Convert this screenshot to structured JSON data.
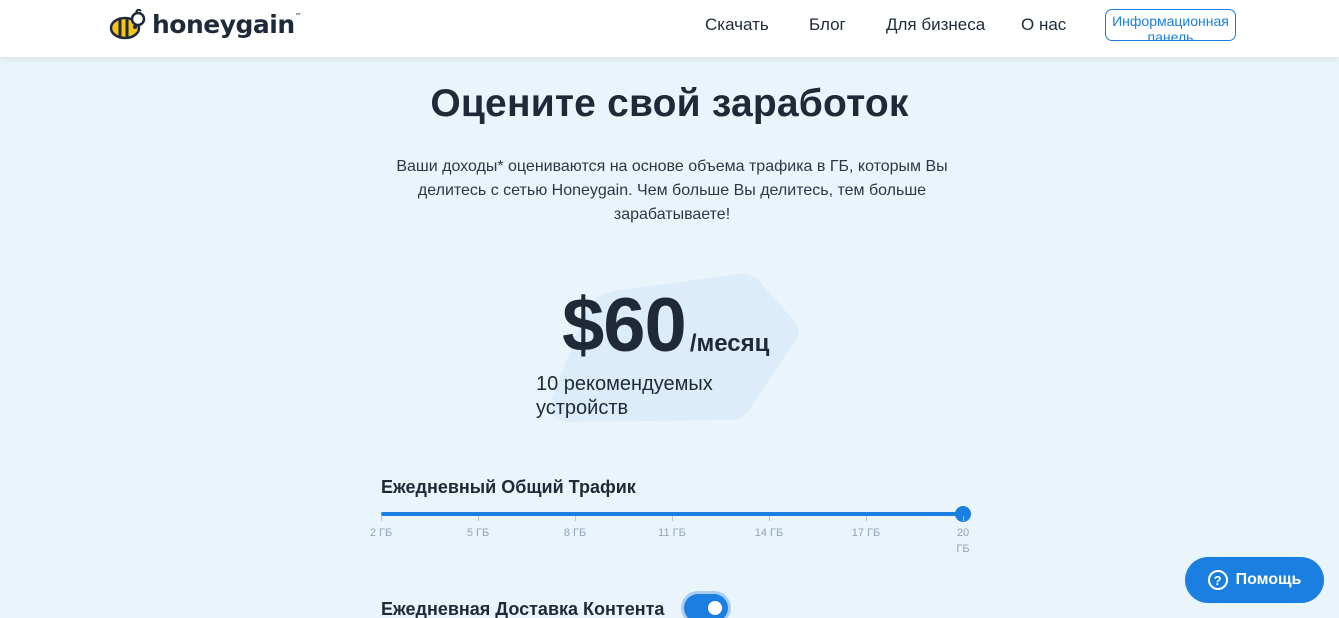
{
  "header": {
    "logo_text": "honeygain",
    "logo_tm": "™",
    "nav": {
      "download": "Скачать",
      "blog": "Блог",
      "business": "Для бизнеса",
      "about": "О нас"
    },
    "dashboard_button": "Информационная панель"
  },
  "hero": {
    "title": "Оцените свой заработок",
    "description": "Ваши доходы* оцениваются на основе объема трафика в ГБ, которым Вы делитесь с сетью Honeygain. Чем больше Вы делитесь, тем больше зарабатываете!"
  },
  "estimate": {
    "amount": "$60",
    "period": "/месяц",
    "devices": "10 рекомендуемых устройств"
  },
  "traffic": {
    "label": "Ежедневный Общий Трафик",
    "ticks": [
      "2 ГБ",
      "5 ГБ",
      "8 ГБ",
      "11 ГБ",
      "14 ГБ",
      "17 ГБ",
      "20 ГБ"
    ],
    "value_fraction": 1.0
  },
  "content_delivery": {
    "label": "Ежедневная Доставка Контента",
    "enabled": true
  },
  "help": {
    "label": "Помощь",
    "icon": "?"
  },
  "colors": {
    "accent": "#1a7fe0",
    "background": "#eaf4fb",
    "logo_yellow": "#f5c518"
  }
}
